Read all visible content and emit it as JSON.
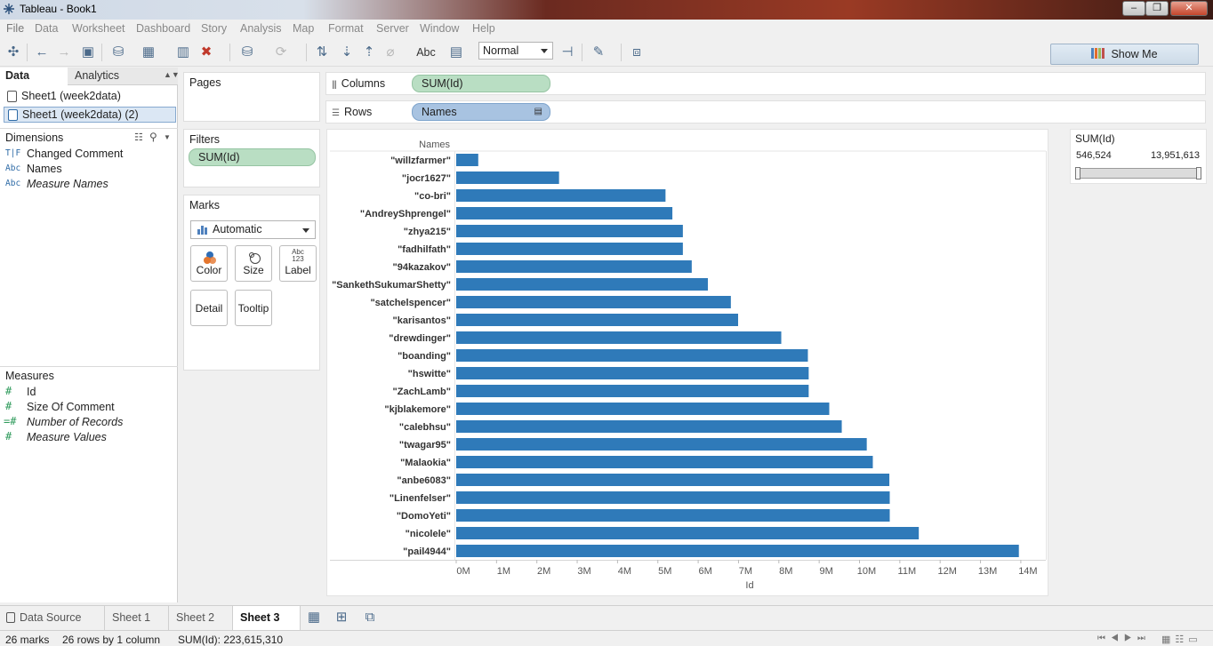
{
  "window": {
    "title": "Tableau - Book1",
    "minimize": "–",
    "maximize": "❐",
    "close": "✕"
  },
  "menu": [
    "File",
    "Data",
    "Worksheet",
    "Dashboard",
    "Story",
    "Analysis",
    "Map",
    "Format",
    "Server",
    "Window",
    "Help"
  ],
  "toolbar": {
    "fit_value": "Normal",
    "abc_label": "Abc",
    "show_me": "Show Me"
  },
  "left_panel": {
    "tab_data": "Data",
    "tab_analytics": "Analytics",
    "datasources": [
      "Sheet1 (week2data)",
      "Sheet1 (week2data) (2)"
    ],
    "dimensions_header": "Dimensions",
    "dimensions": [
      {
        "icon": "T|F",
        "name": "Changed Comment"
      },
      {
        "icon": "Abc",
        "name": "Names"
      },
      {
        "icon": "Abc",
        "name": "Measure Names"
      }
    ],
    "measures_header": "Measures",
    "measures": [
      {
        "icon": "#",
        "name": "Id"
      },
      {
        "icon": "#",
        "name": "Size Of Comment"
      },
      {
        "icon": "=#",
        "name": "Number of Records"
      },
      {
        "icon": "#",
        "name": "Measure Values"
      }
    ]
  },
  "cards": {
    "pages": "Pages",
    "filters": "Filters",
    "filter_pill": "SUM(Id)",
    "marks": "Marks",
    "mark_type": "Automatic",
    "mark_buttons": {
      "color": "Color",
      "size": "Size",
      "label": "Label",
      "label_icon": "Abc\n123",
      "detail": "Detail",
      "tooltip": "Tooltip"
    }
  },
  "shelves": {
    "columns_label": "Columns",
    "columns_pill": "SUM(Id)",
    "rows_label": "Rows",
    "rows_pill": "Names"
  },
  "filter_card": {
    "title": "SUM(Id)",
    "min": "546,524",
    "max": "13,951,613"
  },
  "chart_data": {
    "type": "bar",
    "orientation": "horizontal",
    "row_header": "Names",
    "xlabel": "Id",
    "xlim": [
      0,
      14000000
    ],
    "x_ticks": [
      "0M",
      "1M",
      "2M",
      "3M",
      "4M",
      "5M",
      "6M",
      "7M",
      "8M",
      "9M",
      "10M",
      "11M",
      "12M",
      "13M",
      "14M"
    ],
    "categories": [
      "\"willzfarmer\"",
      "\"jocr1627\"",
      "\"co-bri\"",
      "\"AndreyShprengel\"",
      "\"zhya215\"",
      "\"fadhilfath\"",
      "\"94kazakov\"",
      "\"SankethSukumarShetty\"",
      "\"satchelspencer\"",
      "\"karisantos\"",
      "\"drewdinger\"",
      "\"boanding\"",
      "\"hswitte\"",
      "\"ZachLamb\"",
      "\"kjblakemore\"",
      "\"calebhsu\"",
      "\"twagar95\"",
      "\"Malaokia\"",
      "\"anbe6083\"",
      "\"Linenfelser\"",
      "\"DomoYeti\"",
      "\"nicolele\"",
      "\"pail4944\""
    ],
    "values": [
      546524,
      2550000,
      5190000,
      5360000,
      5620000,
      5620000,
      5840000,
      6240000,
      6810000,
      6990000,
      8060000,
      8720000,
      8740000,
      8740000,
      9250000,
      9560000,
      10180000,
      10330000,
      10740000,
      10750000,
      10750000,
      11470000,
      13951613
    ],
    "bar_color": "#2f7ab9",
    "grid": false
  },
  "sheet_tabs": {
    "data_source": "Data Source",
    "tabs": [
      "Sheet 1",
      "Sheet 2",
      "Sheet 3"
    ],
    "active": "Sheet 3"
  },
  "status": {
    "marks": "26 marks",
    "rows": "26 rows by 1 column",
    "sum": "SUM(Id): 223,615,310"
  }
}
